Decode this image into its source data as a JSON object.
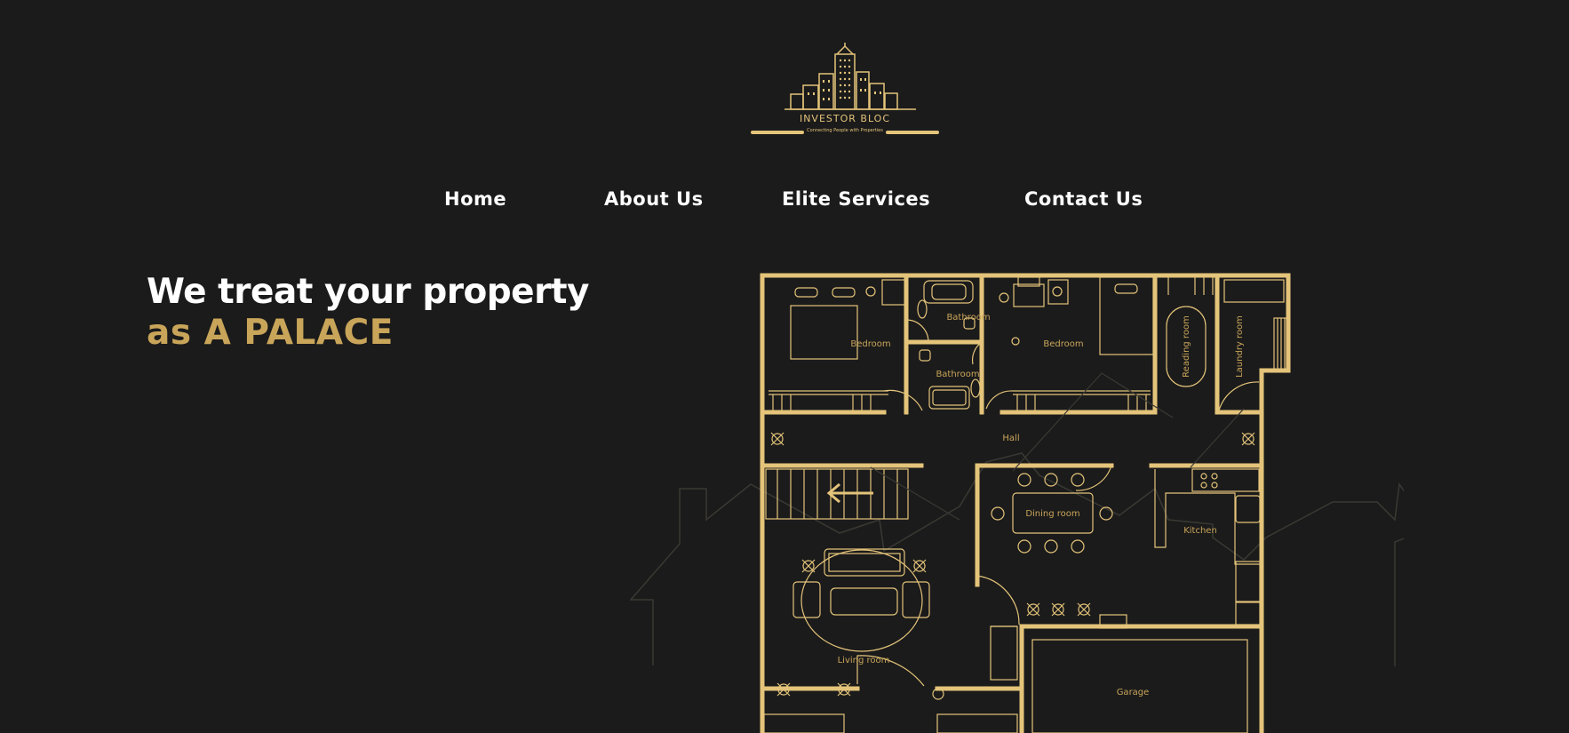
{
  "brand": {
    "name": "INVESTOR BLOC",
    "tagline": "Connecting People with Properties",
    "gold": "#e4c47a",
    "accent": "#c9a55a",
    "background": "#1b1b1b",
    "icon": "city-skyline-icon"
  },
  "nav": {
    "items": [
      {
        "label": "Home"
      },
      {
        "label": "About Us"
      },
      {
        "label": "Elite Services"
      },
      {
        "label": "Contact Us"
      }
    ]
  },
  "hero": {
    "line1": "We treat your property",
    "line2": "as A PALACE"
  },
  "floorplan": {
    "icon": "floor-plan-illustration",
    "rooms": {
      "bedroom1": "Bedroom",
      "bathroom1": "Bathroom",
      "bathroom2": "Bathroom",
      "bedroom2": "Bedroom",
      "reading": "Reading room",
      "laundry": "Laundry room",
      "hall": "Hall",
      "dining": "Dining room",
      "kitchen": "Kitchen",
      "living": "Living room",
      "garage": "Garage"
    }
  }
}
